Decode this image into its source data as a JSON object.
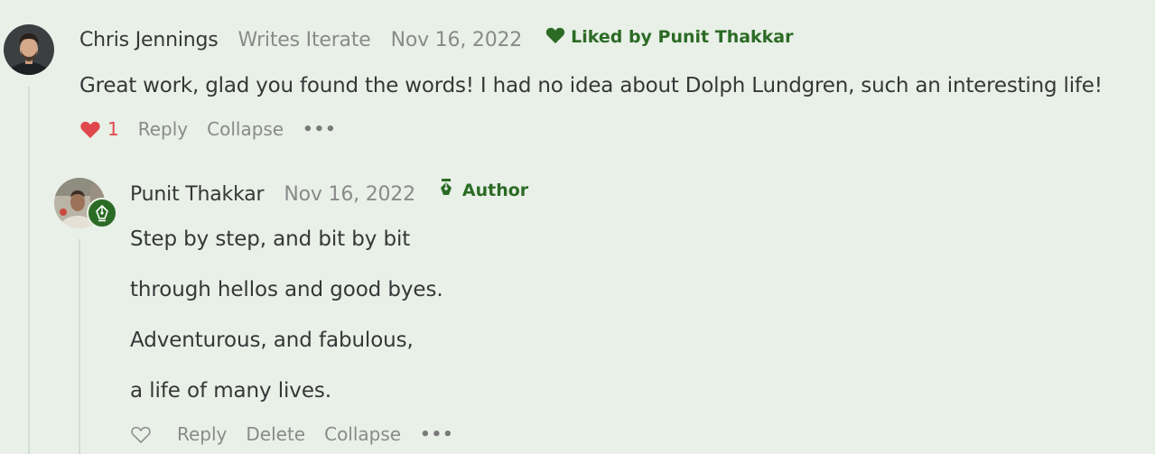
{
  "comment": {
    "author_name": "Chris Jennings",
    "author_publication": "Writes Iterate",
    "date": "Nov 16, 2022",
    "liked_by": "Liked by Punit Thakkar",
    "body": "Great work, glad you found the words! I had no idea about Dolph Lundgren, such an interesting life!",
    "actions": {
      "like_count": "1",
      "reply": "Reply",
      "collapse": "Collapse",
      "more": "•••"
    }
  },
  "reply": {
    "author_name": "Punit Thakkar",
    "date": "Nov 16, 2022",
    "author_label": "Author",
    "lines": [
      "Step by step, and bit by bit",
      "through hellos and good byes.",
      "Adventurous, and fabulous,",
      "a life of many lives."
    ],
    "actions": {
      "reply": "Reply",
      "delete": "Delete",
      "collapse": "Collapse",
      "more": "•••"
    }
  },
  "colors": {
    "background": "#e9f0e8",
    "accent_green": "#2b6b25",
    "like_red": "#e0474c",
    "muted_text": "#8a8a8a"
  }
}
